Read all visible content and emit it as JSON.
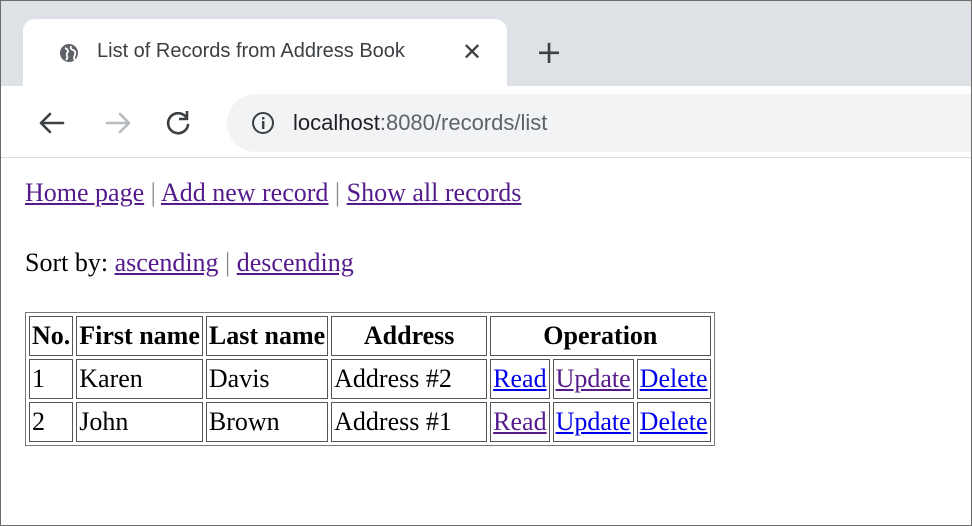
{
  "browser": {
    "tab": {
      "title": "List of Records from Address Book",
      "close_glyph": "✕",
      "icon": "globe-icon"
    },
    "new_tab_glyph": "+",
    "toolbar": {
      "back_icon": "back-arrow-icon",
      "forward_icon": "forward-arrow-icon",
      "reload_icon": "reload-icon",
      "info_icon": "info-icon"
    },
    "address_bar": {
      "host": "localhost",
      "path": ":8080/records/list"
    }
  },
  "page": {
    "nav_links": [
      "Home page",
      "Add new record",
      "Show all records"
    ],
    "separator": "|",
    "sort": {
      "label": "Sort by:",
      "options": [
        "ascending",
        "descending"
      ]
    },
    "table": {
      "headers": [
        "No.",
        "First name",
        "Last name",
        "Address",
        "Operation"
      ],
      "rows": [
        {
          "no": "1",
          "first_name": "Karen",
          "last_name": "Davis",
          "address": "Address #2",
          "ops": [
            "Read",
            "Update",
            "Delete"
          ]
        },
        {
          "no": "2",
          "first_name": "John",
          "last_name": "Brown",
          "address": "Address #1",
          "ops": [
            "Read",
            "Update",
            "Delete"
          ]
        }
      ]
    }
  },
  "colors": {
    "visited_link": "#551a8b",
    "unvisited_link": "#0000ee",
    "tabstrip_bg": "#dee1e6",
    "omnibox_bg": "#f1f3f4"
  }
}
